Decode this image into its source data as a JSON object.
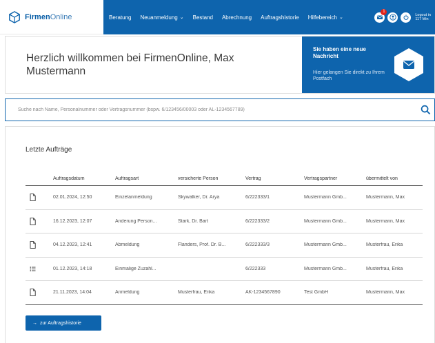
{
  "brand": {
    "name_bold": "Firmen",
    "name_light": "Online"
  },
  "nav": {
    "items": [
      {
        "label": "Beratung",
        "dropdown": false
      },
      {
        "label": "Neuanmeldung",
        "dropdown": true
      },
      {
        "label": "Bestand",
        "dropdown": false
      },
      {
        "label": "Abrechnung",
        "dropdown": false
      },
      {
        "label": "Auftragshistorie",
        "dropdown": false
      },
      {
        "label": "Hilfebereich",
        "dropdown": true
      }
    ],
    "message_badge": "1",
    "logout_line1": "Logout in",
    "logout_line2": "117 Min"
  },
  "welcome": {
    "title": "Herzlich willkommen bei FirmenOnline, Max Mustermann",
    "message_heading": "Sie haben eine neue Nachricht",
    "message_sub": "Hier gelangen Sie direkt zu Ihrem Postfach"
  },
  "search": {
    "placeholder": "Suche nach Name, Personalnummer oder Vertragsnummer (bspw. 6/123456/00003 oder AL-1234567789)"
  },
  "orders": {
    "title": "Letzte Aufträge",
    "columns": [
      "Auftragsdatum",
      "Auftragsart",
      "versicherte Person",
      "Vertrag",
      "Vertragspartner",
      "übermittelt von"
    ],
    "rows": [
      {
        "icon": "document-icon",
        "date": "02.01.2024, 12:50",
        "type": "Einzelanmeldung",
        "person": "Skywalker, Dr. Arya",
        "contract": "6/222333/1",
        "partner": "Mustermann Gmb...",
        "sender": "Mustermann, Max"
      },
      {
        "icon": "document-icon",
        "date": "16.12.2023, 12:07",
        "type": "Änderung Person...",
        "person": "Stark, Dr. Bart",
        "contract": "6/222333/2",
        "partner": "Mustermann Gmb...",
        "sender": "Mustermann, Max"
      },
      {
        "icon": "document-icon",
        "date": "04.12.2023, 12:41",
        "type": "Abmeldung",
        "person": "Flanders, Prof. Dr. B...",
        "contract": "6/222333/3",
        "partner": "Mustermann Gmb...",
        "sender": "Musterfrau, Erika"
      },
      {
        "icon": "list-icon",
        "date": "01.12.2023, 14:18",
        "type": "Einmalige Zuzahl...",
        "person": "",
        "contract": "6/222333",
        "partner": "Mustermann Gmb...",
        "sender": "Musterfrau, Erika"
      },
      {
        "icon": "document-icon",
        "date": "21.11.2023, 14:04",
        "type": "Anmeldung",
        "person": "Musterfrau, Erika",
        "contract": "AK-1234567890",
        "partner": "Test GmbH",
        "sender": "Mustermann, Max"
      }
    ],
    "history_button": "zur Auftragshistorie"
  },
  "colors": {
    "primary": "#0e64ad",
    "badge": "#e2231a"
  }
}
